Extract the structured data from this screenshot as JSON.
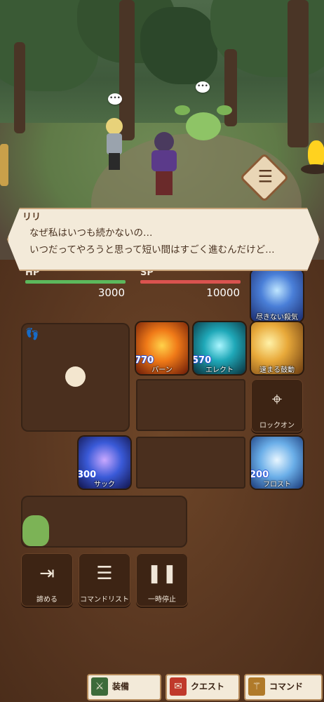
{
  "dialogue": {
    "speaker": "リリ",
    "line1": "なぜ私はいつも続かないの…",
    "line2": "いつだってやろうと思って短い間はすごく進むんだけど…"
  },
  "status": {
    "hp_label": "HP",
    "hp_value": "3000",
    "sp_label": "SP",
    "sp_value": "10000",
    "hp_color": "#5cb85c",
    "sp_color": "#d9534f"
  },
  "skills": {
    "endless": {
      "label": "尽きない殺気"
    },
    "burn": {
      "label": "バーン",
      "cost": "770"
    },
    "elect": {
      "label": "エレクト",
      "cost": "570"
    },
    "drum": {
      "label": "速まる鼓動"
    },
    "lockon": {
      "label": "ロックオン"
    },
    "suck": {
      "label": "サック",
      "cost": "300"
    },
    "frost": {
      "label": "フロスト",
      "cost": "200"
    }
  },
  "buttons": {
    "giveup": "諦める",
    "commandlist": "コマンドリスト",
    "pause": "一時停止"
  },
  "tabs": {
    "equip": "装備",
    "quest": "クエスト",
    "command": "コマンド"
  }
}
